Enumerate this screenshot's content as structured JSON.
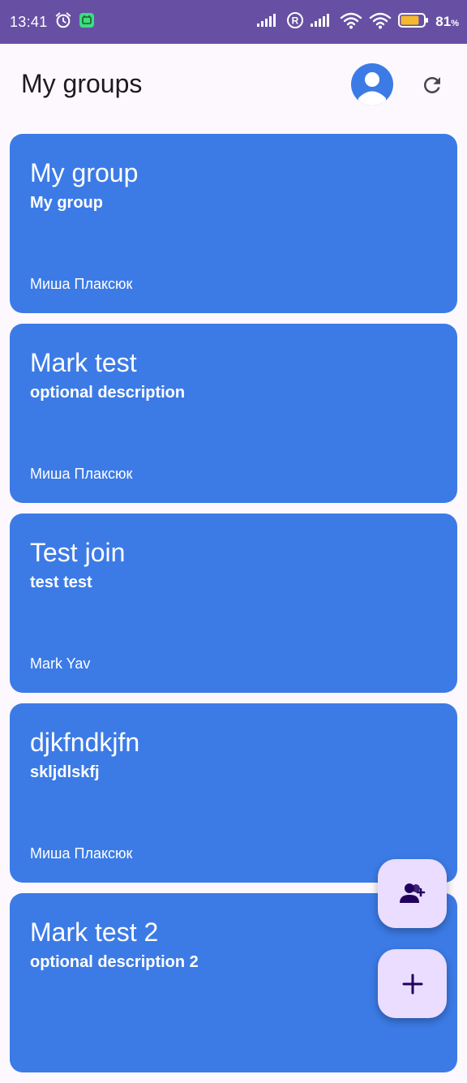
{
  "status_bar": {
    "time": "13:41",
    "battery_percent": "81",
    "battery_symbol": "%",
    "battery_level": 0.81,
    "icons": [
      "alarm-icon",
      "app-notification-icon",
      "signal-icon",
      "roaming-icon",
      "signal-icon",
      "wifi-icon",
      "wifi-icon",
      "battery-icon"
    ]
  },
  "app_bar": {
    "title": "My groups",
    "icons": [
      "profile-icon",
      "refresh-icon"
    ]
  },
  "groups": [
    {
      "title": "My group",
      "description": "My group",
      "owner": "Миша Плаксюк"
    },
    {
      "title": "Mark test",
      "description": "optional description",
      "owner": "Миша Плаксюк"
    },
    {
      "title": "Test join",
      "description": "test test",
      "owner": "Mark Yav"
    },
    {
      "title": "djkfndkjfn",
      "description": "skljdlskfj",
      "owner": "Миша Плаксюк"
    },
    {
      "title": "Mark test 2",
      "description": "optional description 2",
      "owner": ""
    }
  ],
  "fabs": {
    "icons": [
      "add-person-icon",
      "plus-icon"
    ]
  },
  "colors": {
    "status_bar": "#6750a4",
    "card": "#3c7be6",
    "background": "#fdf8fd",
    "fab": "#eaddff",
    "fab_icon": "#21005d"
  }
}
